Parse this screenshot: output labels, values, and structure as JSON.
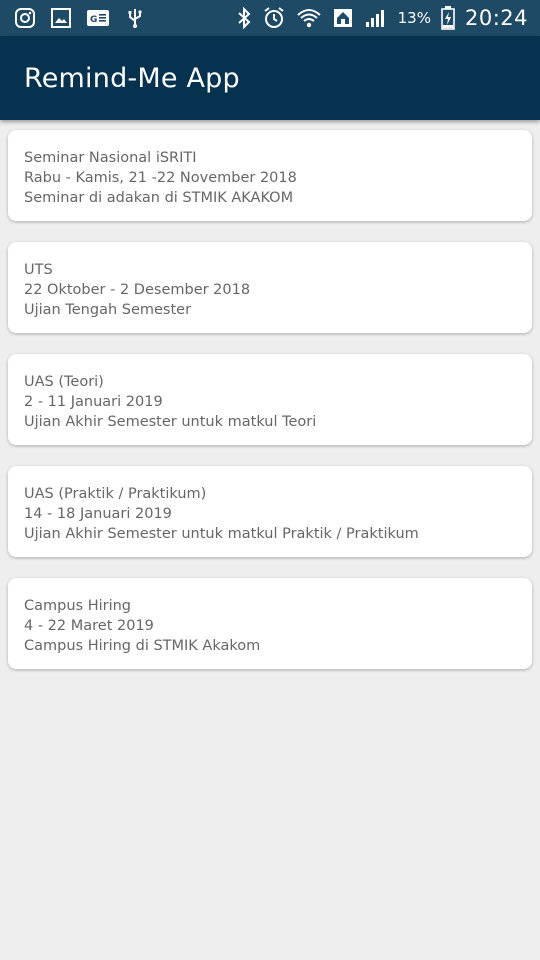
{
  "status_bar": {
    "icons_left": [
      "instagram-icon",
      "gallery-icon",
      "translate-icon",
      "usb-icon"
    ],
    "icons_right": [
      "bluetooth-icon",
      "alarm-icon",
      "wifi-icon",
      "home-icon",
      "signal-icon",
      "battery-icon"
    ],
    "battery": "13%",
    "time": "20:24"
  },
  "app_bar": {
    "title": "Remind-Me App",
    "color": "#06324f"
  },
  "reminders": [
    {
      "title": "Seminar Nasional iSRITI",
      "date": "Rabu - Kamis, 21 -22 November 2018",
      "description": "Seminar di adakan di STMIK AKAKOM"
    },
    {
      "title": "UTS",
      "date": "22 Oktober - 2 Desember 2018",
      "description": "Ujian Tengah Semester"
    },
    {
      "title": "UAS (Teori)",
      "date": "2 - 11 Januari 2019",
      "description": "Ujian Akhir Semester untuk matkul Teori"
    },
    {
      "title": "UAS (Praktik / Praktikum)",
      "date": "14 - 18 Januari 2019",
      "description": "Ujian Akhir Semester untuk matkul Praktik / Praktikum"
    },
    {
      "title": "Campus Hiring",
      "date": "4 - 22 Maret 2019",
      "description": "Campus Hiring di STMIK Akakom"
    }
  ]
}
